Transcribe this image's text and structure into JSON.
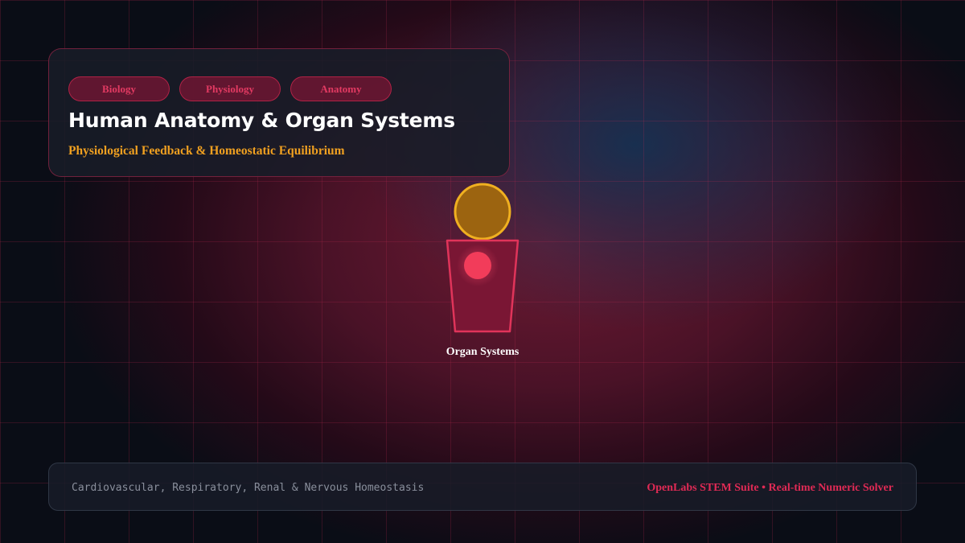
{
  "header": {
    "tags": [
      "Biology",
      "Physiology",
      "Anatomy"
    ],
    "title": "Human Anatomy & Organ Systems",
    "subtitle": "Physiological Feedback & Homeostatic Equilibrium"
  },
  "figure": {
    "label": "Organ Systems",
    "icons": {
      "head": "head-icon",
      "torso": "torso-icon",
      "heart": "heart-icon"
    },
    "colors": {
      "head_fill": "#9c6410",
      "head_stroke": "#f0b020",
      "torso_fill": "#7a1634",
      "torso_stroke": "#e0345a",
      "heart": "#f23c5a"
    }
  },
  "footer": {
    "left_text": "Cardiovascular, Respiratory, Renal & Nervous Homeostasis",
    "right_text": "OpenLabs STEM Suite • Real-time Numeric Solver"
  },
  "colors": {
    "accent": "#e02a55",
    "highlight": "#f0a020",
    "background": "#0a0d16"
  }
}
